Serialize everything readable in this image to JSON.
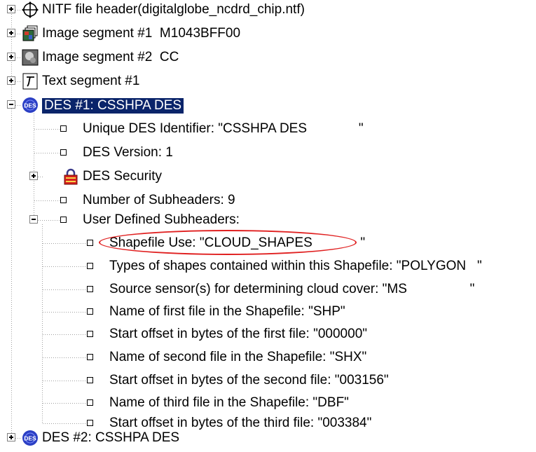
{
  "tree": {
    "top_items": [
      {
        "label": "NITF file header(digitalglobe_ncdrd_chip.ntf)",
        "icon": "crosshair-globe-icon"
      },
      {
        "label": "Image segment #1  M1043BFF00",
        "icon": "image-stack-icon"
      },
      {
        "label": "Image segment #2  CC",
        "icon": "image-thumbnail-icon"
      },
      {
        "label": "Text segment #1",
        "icon": "text-t-icon"
      },
      {
        "label": "DES #1: CSSHPA DES",
        "icon": "des-icon",
        "state": "expanded",
        "selected": true,
        "icon_text": "DES"
      }
    ],
    "des1_children": [
      {
        "label": "Unique DES Identifier: \"CSSHPA DES              \""
      },
      {
        "label": "DES Version: 1"
      },
      {
        "label": "DES Security",
        "icon": "padlock-icon"
      },
      {
        "label": "Number of Subheaders: 9"
      },
      {
        "label": "User Defined Subheaders:"
      }
    ],
    "subheaders": [
      {
        "label": "Shapefile Use: \"CLOUD_SHAPES             \""
      },
      {
        "label": "Types of shapes contained within this Shapefile: \"POLYGON   \""
      },
      {
        "label": "Source sensor(s) for determining cloud cover: \"MS                 \""
      },
      {
        "label": "Name of first file in the Shapefile: \"SHP\""
      },
      {
        "label": "Start offset in bytes of the first file: \"000000\""
      },
      {
        "label": "Name of second file in the Shapefile: \"SHX\""
      },
      {
        "label": "Start offset in bytes of the second file: \"003156\""
      },
      {
        "label": "Name of third file in the Shapefile: \"DBF\""
      },
      {
        "label": "Start offset in bytes of the third file: \"003384\""
      }
    ],
    "last_item": {
      "label": "DES #2: CSSHPA DES",
      "icon": "des-icon",
      "icon_text": "DES"
    }
  },
  "colors": {
    "selection": "#0a246a",
    "callout": "#e02020",
    "des_icon": "#2b3fc4"
  }
}
